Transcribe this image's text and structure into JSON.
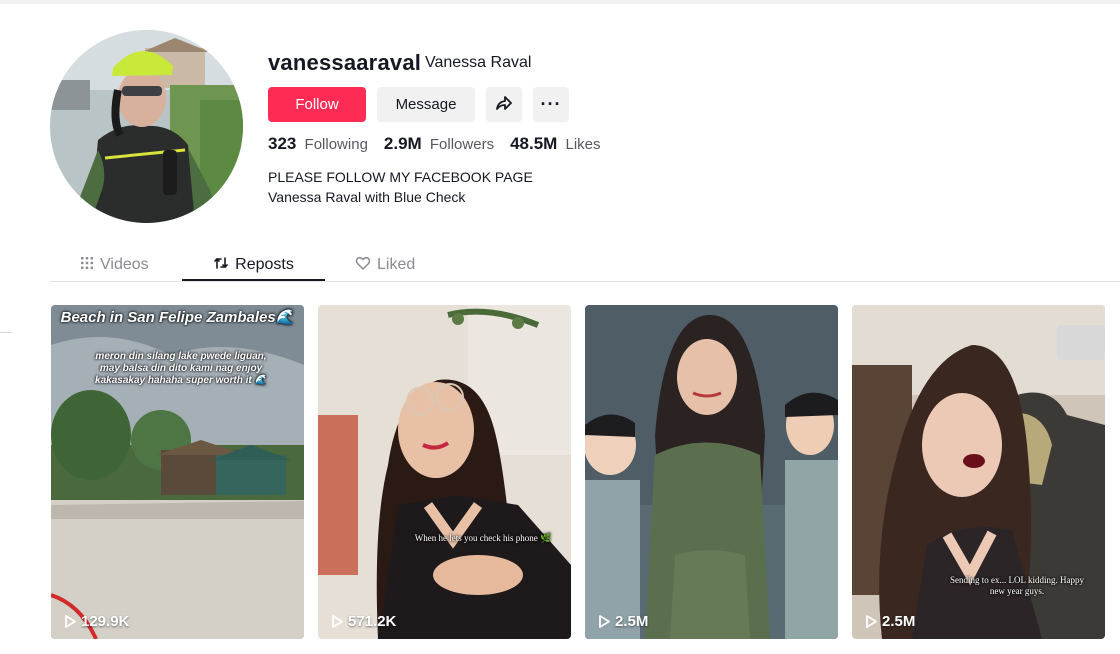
{
  "profile": {
    "username": "vanessaaraval",
    "nickname": "Vanessa Raval",
    "follow_label": "Follow",
    "message_label": "Message",
    "more_label": "···",
    "stats": {
      "following_count": "323",
      "following_label": "Following",
      "followers_count": "2.9M",
      "followers_label": "Followers",
      "likes_count": "48.5M",
      "likes_label": "Likes"
    },
    "bio_line1": "PLEASE FOLLOW MY FACEBOOK PAGE",
    "bio_line2": "Vanessa Raval with Blue Check"
  },
  "tabs": [
    {
      "label": "Videos",
      "icon": "grid-icon",
      "active": false
    },
    {
      "label": "Reposts",
      "icon": "repost-icon",
      "active": true
    },
    {
      "label": "Liked",
      "icon": "heart-icon",
      "active": false
    }
  ],
  "videos": [
    {
      "views": "129.9K",
      "overlay_title": "Beach in San Felipe Zambales🌊",
      "overlay_text": "meron din silang lake pwede liguan, may balsa din dito kami nag enjoy kakasakay hahaha super worth it 🌊"
    },
    {
      "views": "571.2K",
      "overlay_text": "When he lets you check his phone 🌿"
    },
    {
      "views": "2.5M"
    },
    {
      "views": "2.5M",
      "overlay_text": "Sending to ex... LOL kidding. Happy new year guys."
    }
  ],
  "colors": {
    "accent": "#fe2c55",
    "button_bg": "#f1f1f2",
    "text_primary": "#161823",
    "text_secondary": "#8a8b91"
  }
}
